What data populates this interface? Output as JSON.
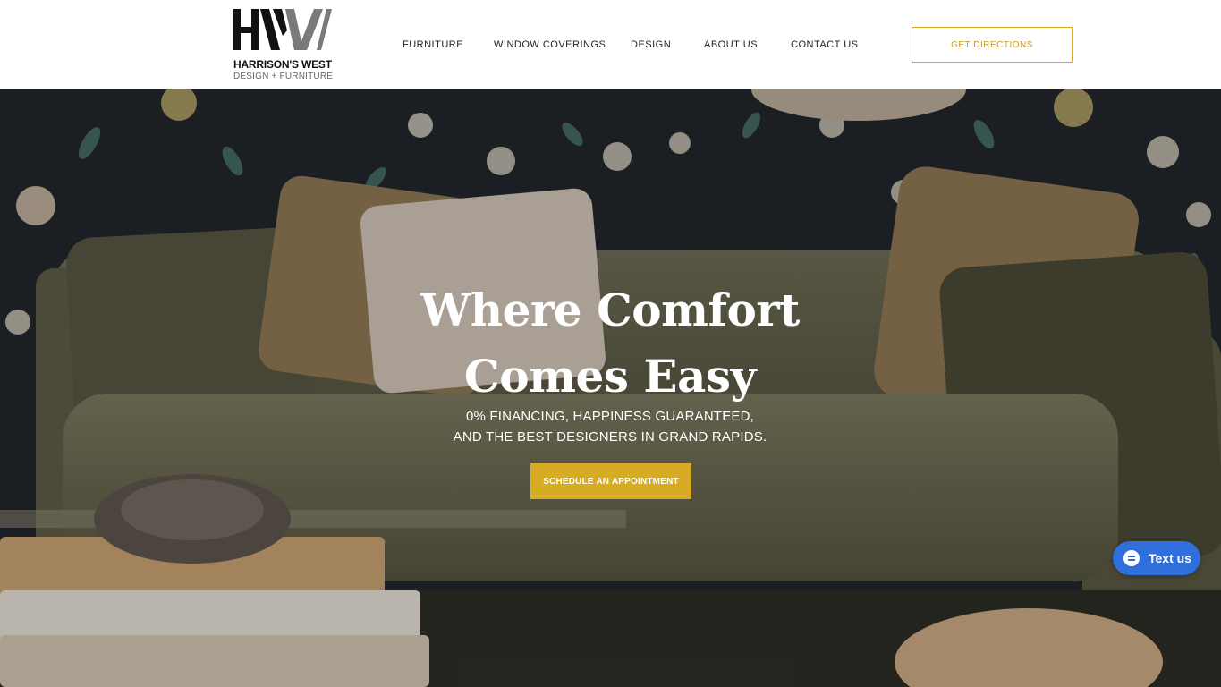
{
  "brand": {
    "name": "HARRISON'S WEST",
    "tagline": "DESIGN + FURNITURE",
    "monogram": "HW"
  },
  "nav": {
    "items": [
      {
        "label": "FURNITURE"
      },
      {
        "label": "WINDOW COVERINGS"
      },
      {
        "label": "DESIGN"
      },
      {
        "label": "ABOUT US"
      },
      {
        "label": "CONTACT US"
      }
    ],
    "directions_label": "GET DIRECTIONS"
  },
  "hero": {
    "title_line1": "Where Comfort",
    "title_line2": "Comes Easy",
    "subtitle_line1": "0% FINANCING, HAPPINESS GUARANTEED,",
    "subtitle_line2": "AND THE BEST DESIGNERS IN GRAND RAPIDS.",
    "cta_label": "SCHEDULE AN APPOINTMENT",
    "image": "sofa-living-room-photo"
  },
  "chat_widget": {
    "label": "Text us",
    "icon": "chat-bubble-icon"
  },
  "colors": {
    "accent_gold": "#d7ac24",
    "chat_blue": "#2e6fdc",
    "wallpaper_navy": "#23262c"
  }
}
